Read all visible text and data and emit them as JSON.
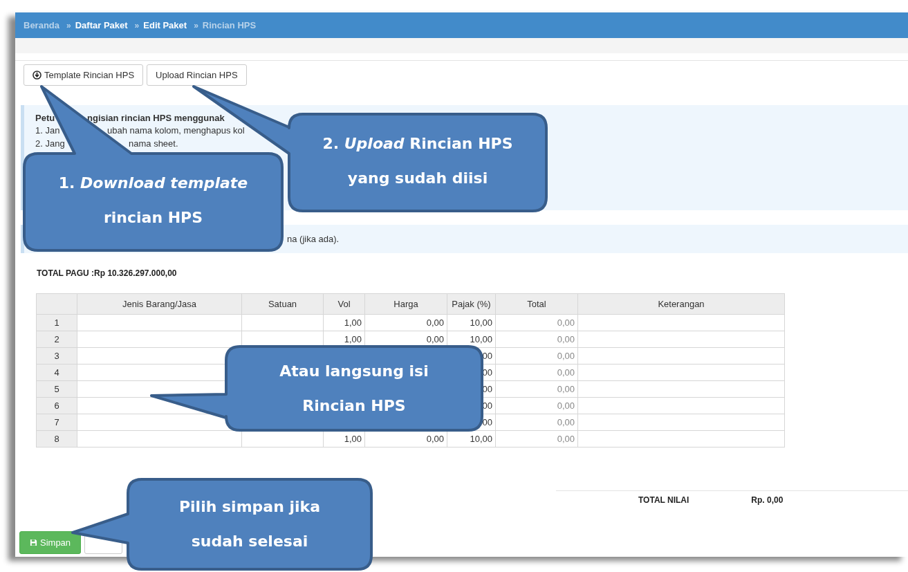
{
  "breadcrumb": [
    {
      "label": "Beranda",
      "muted": true
    },
    {
      "prefix": "»",
      "label": "Daftar Paket",
      "muted": false
    },
    {
      "prefix": "»",
      "label": "Edit Paket",
      "muted": false
    },
    {
      "prefix": "»",
      "label": "Rincian HPS",
      "muted": true
    }
  ],
  "actions": [
    {
      "label": "Template Rincian HPS",
      "has_icon": true
    },
    {
      "label": "Upload Rincian HPS",
      "has_icon": false
    }
  ],
  "instructions": [
    {
      "kind": "heading",
      "fragments": [
        "Petu",
        "ngisian rincian HPS menggunak"
      ]
    },
    {
      "kind": "item",
      "fragments": [
        "1. Jan",
        "ubah nama kolom, menghapus kol"
      ]
    },
    {
      "kind": "item",
      "fragments": [
        "2. Jang",
        "nama sheet."
      ]
    }
  ],
  "note": {
    "fragments": [
      "na (jika ada)."
    ]
  },
  "total_pagu": "TOTAL PAGU :Rp 10.326.297.000,00",
  "table": {
    "columns": [
      "Jenis Barang/Jasa",
      "Satuan",
      "Vol",
      "Harga",
      "Pajak (%)",
      "Total",
      "Keterangan"
    ],
    "rows": [
      {
        "number": "1",
        "vol": "1,00",
        "harga": "0,00",
        "pajak": "10,00",
        "total": "0,00"
      },
      {
        "number": "2",
        "vol": "1,00",
        "harga": "0,00",
        "pajak": "10,00",
        "total": "0,00"
      },
      {
        "number": "3",
        "pajak": "00",
        "total": "0,00"
      },
      {
        "number": "4",
        "pajak": "00",
        "total": "0,00"
      },
      {
        "number": "5",
        "pajak": "00",
        "total": "0,00"
      },
      {
        "number": "6",
        "pajak": "00",
        "total": "0,00"
      },
      {
        "number": "7",
        "pajak": "00",
        "total": "0,00"
      },
      {
        "number": "8",
        "vol": "1,00",
        "harga": "0,00",
        "pajak": "10,00",
        "total": "0,00"
      }
    ]
  },
  "totals": {
    "label": "TOTAL NILAI",
    "value": "Rp. 0,00"
  },
  "buttons": [
    {
      "kind": "primary",
      "label": "Simpan"
    },
    {
      "kind": "secondary"
    }
  ],
  "callouts": [
    {
      "lines": [
        "1. *Download template*",
        "rincian HPS"
      ]
    },
    {
      "lines": [
        "2. *Upload* Rincian HPS",
        "yang sudah diisi"
      ]
    },
    {
      "lines": [
        "Atau langsung isi",
        "Rincian HPS"
      ]
    },
    {
      "lines": [
        "Pilih simpan jika",
        "sudah selesai"
      ]
    }
  ]
}
